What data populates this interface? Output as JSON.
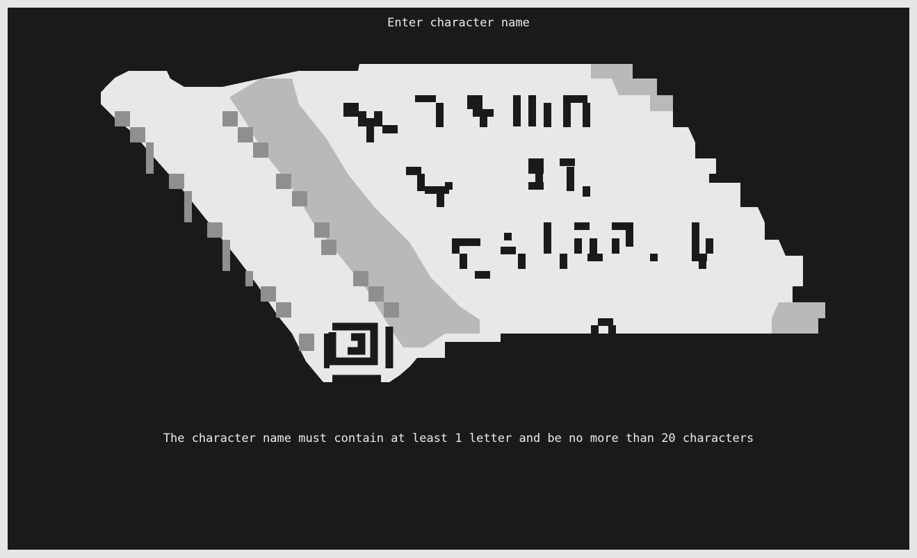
{
  "screen": {
    "title": "Enter character name",
    "validation_message": "The character name must contain at least 1 letter and be no more than 20 characters"
  },
  "scroll": {
    "icon": "parchment-scroll-icon",
    "colors": {
      "paper": "#e8e8e8",
      "shade": "#b9b9b9",
      "dark_shade": "#8f8f8f",
      "ink": "#1a1a1a",
      "background": "#1a1a1a"
    }
  }
}
